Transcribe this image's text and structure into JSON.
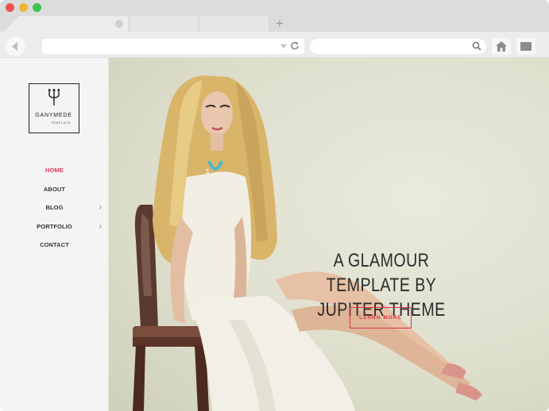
{
  "browser": {
    "new_tab_symbol": "+",
    "icons": {
      "back": "back-arrow-icon",
      "reload": "reload-icon",
      "search": "search-icon",
      "home": "home-icon",
      "menu": "menu-icon"
    },
    "traffic_colors": {
      "close": "#f2524c",
      "minimize": "#f5b42d",
      "maximize": "#3dc24e"
    }
  },
  "sidebar": {
    "logo": {
      "name": "GANYMEDE",
      "subtitle": "TEMPLATE",
      "icon": "trident-icon"
    },
    "items": [
      {
        "label": "HOME",
        "active": true,
        "has_submenu": false
      },
      {
        "label": "ABOUT",
        "active": false,
        "has_submenu": false
      },
      {
        "label": "BLOG",
        "active": false,
        "has_submenu": true
      },
      {
        "label": "PORTFOLIO",
        "active": false,
        "has_submenu": true
      },
      {
        "label": "CONTACT",
        "active": false,
        "has_submenu": false
      }
    ],
    "submenu_symbol": "›"
  },
  "hero": {
    "title_line1": "A GLAMOUR TEMPLATE BY",
    "title_line2": "JUPITER THEME",
    "button_label": "LEARN MORE",
    "accent_color": "#d7334f"
  }
}
